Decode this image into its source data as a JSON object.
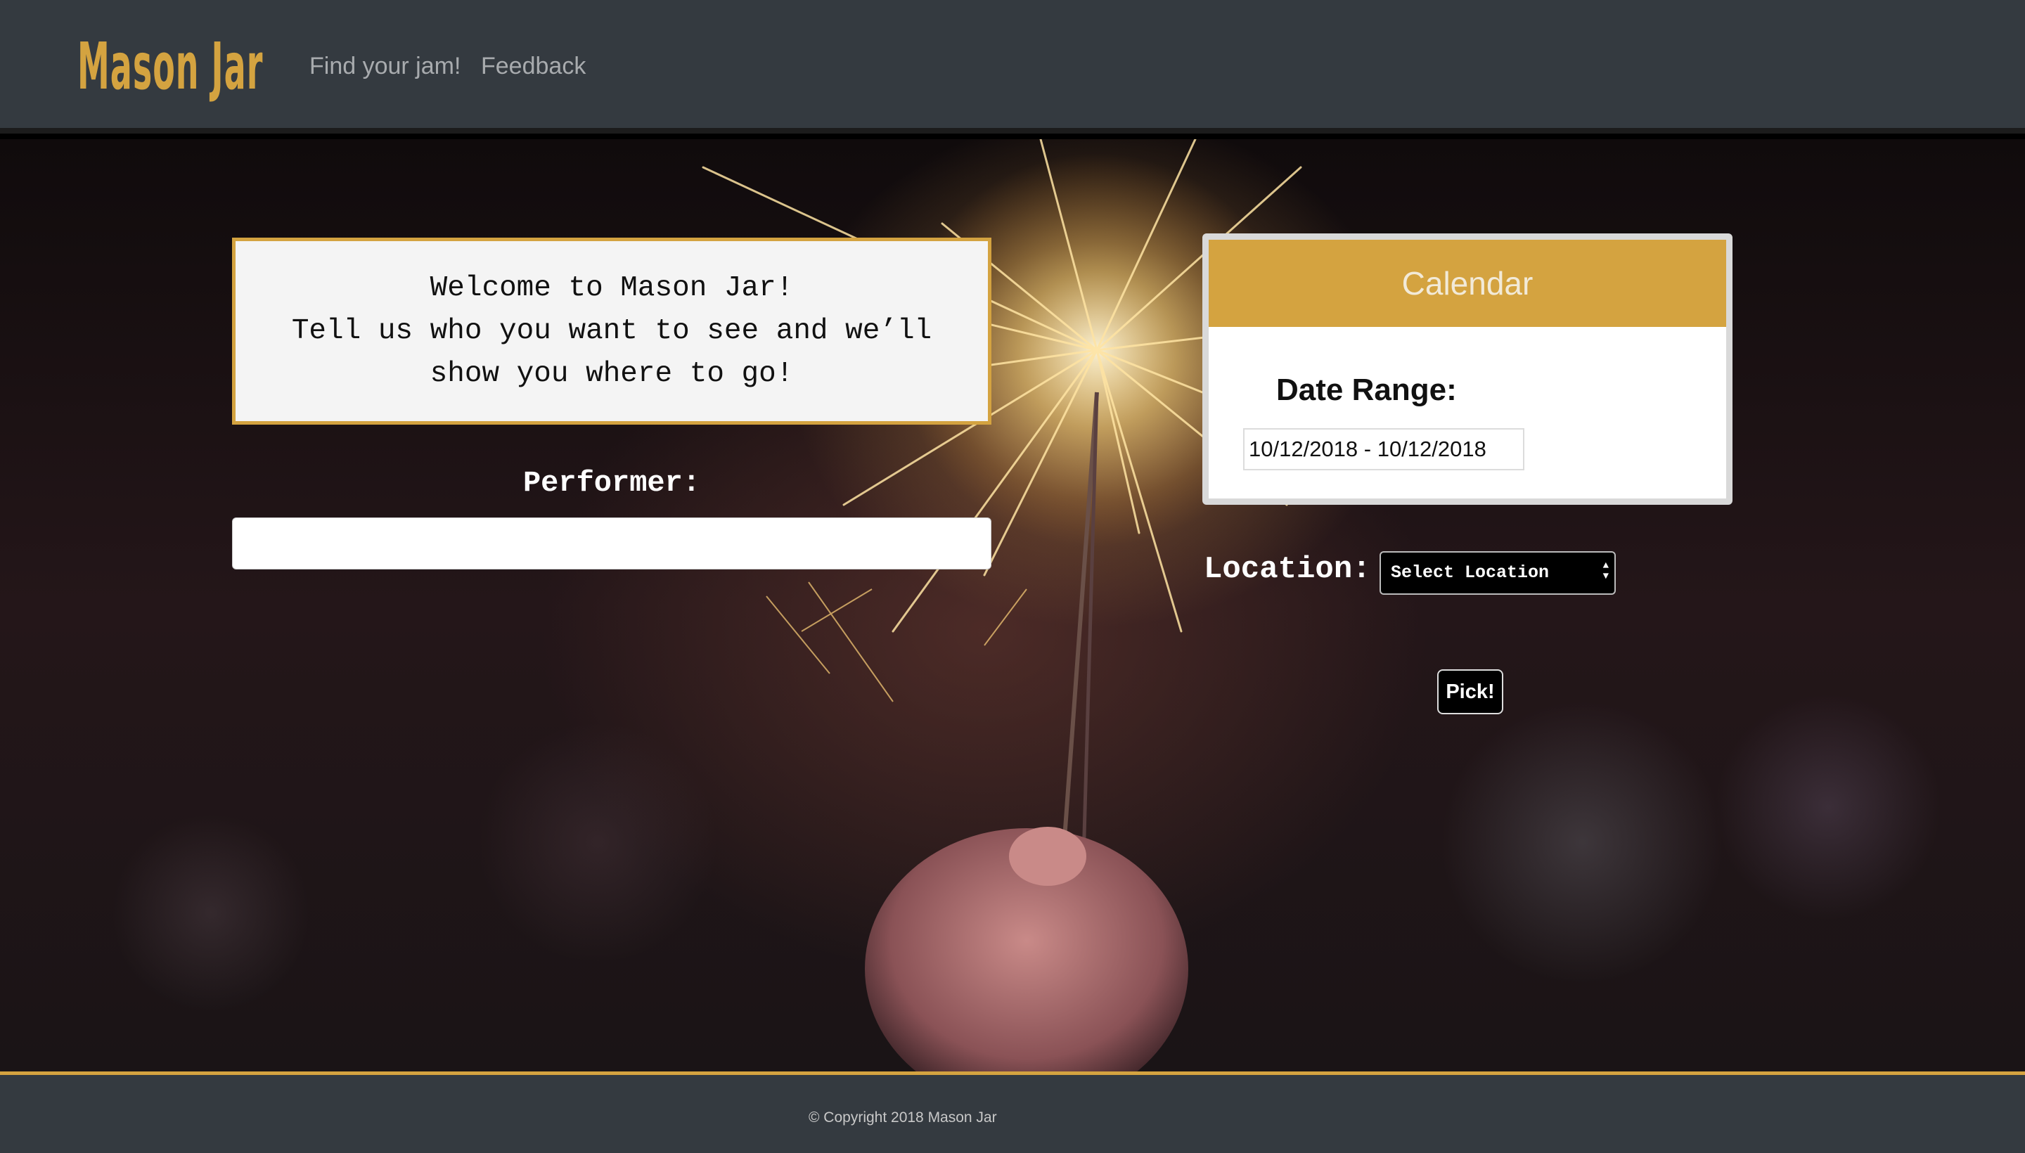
{
  "nav": {
    "brand": "Mason Jar",
    "links": [
      "Find your jam!",
      "Feedback"
    ]
  },
  "welcome": {
    "lines": [
      "Welcome to Mason Jar!",
      "Tell us who you want to see and we’ll",
      "show you where to go!"
    ]
  },
  "performer": {
    "label": "Performer:",
    "value": ""
  },
  "calendar": {
    "title": "Calendar",
    "date_range_label": "Date Range:",
    "date_range_value": "10/12/2018 - 10/12/2018"
  },
  "location": {
    "label": "Location:",
    "selected": "Select Location"
  },
  "pick_button": "Pick!",
  "footer": {
    "copyright": "© Copyright 2018 Mason Jar"
  },
  "colors": {
    "accent": "#d4a340",
    "navbar": "#343a40",
    "footer": "#343a40"
  },
  "icons": {
    "select": "up-down-arrows-icon"
  }
}
